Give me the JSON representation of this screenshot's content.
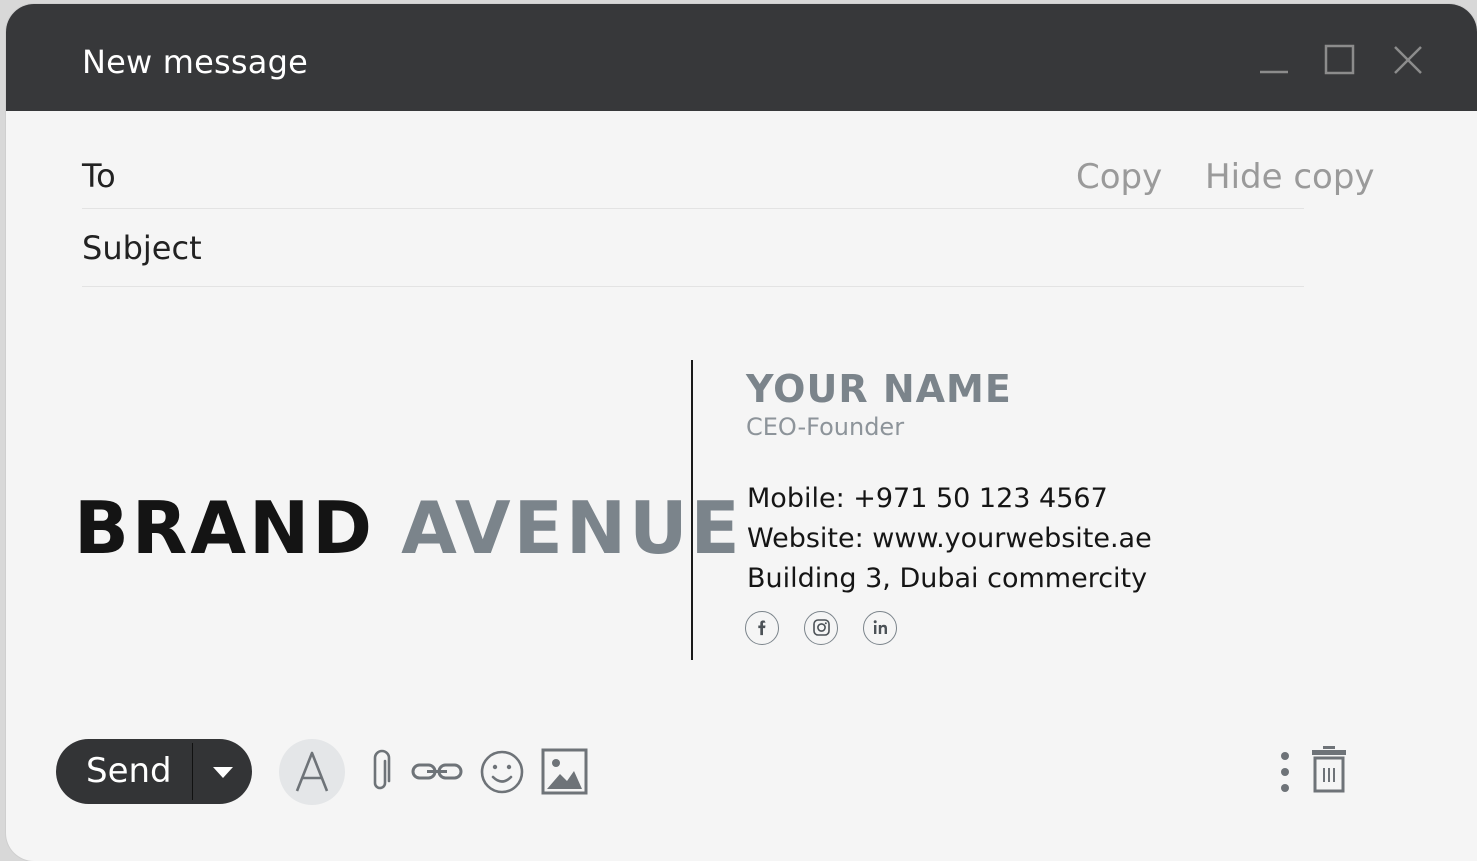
{
  "window": {
    "title": "New message"
  },
  "compose": {
    "to_label": "To",
    "copy_label": "Copy",
    "hide_copy_label": "Hide copy",
    "subject_label": "Subject"
  },
  "signature": {
    "brand_first": "BRAND",
    "brand_second": "AVENUE",
    "name": "YOUR NAME",
    "role": "CEO-Founder",
    "mobile": "Mobile: +971 50 123 4567",
    "website": "Website: www.yourwebsite.ae",
    "address": "Building 3, Dubai commercity",
    "social_icons": [
      "facebook-icon",
      "instagram-icon",
      "linkedin-icon"
    ]
  },
  "toolbar": {
    "send_label": "Send",
    "icons": [
      "chevron-down-icon",
      "text-format-icon",
      "attachment-icon",
      "link-icon",
      "emoji-icon",
      "image-icon",
      "more-vertical-icon",
      "trash-icon"
    ]
  },
  "colors": {
    "titlebar": "#37383a",
    "background": "#f5f5f5",
    "accent_gray": "#7b848b",
    "send_button": "#333436"
  }
}
